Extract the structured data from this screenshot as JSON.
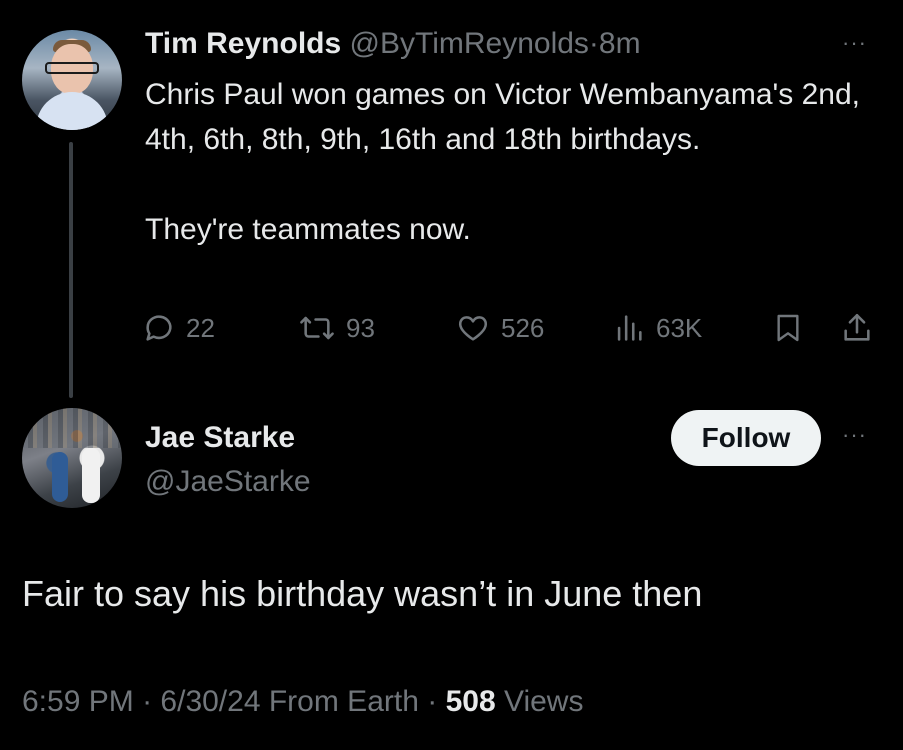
{
  "tweet1": {
    "author_name": "Tim Reynolds",
    "author_handle": "@ByTimReynolds",
    "separator": "·",
    "time_ago": "8m",
    "more": "···",
    "text_line1": "Chris Paul won games on Victor Wembanyama's 2nd, 4th, 6th, 8th, 9th, 16th and 18th birthdays.",
    "text_line2": "They're teammates now.",
    "replies": "22",
    "reposts": "93",
    "likes": "526",
    "views": "63K"
  },
  "tweet2": {
    "author_name": "Jae Starke",
    "author_handle": "@JaeStarke",
    "follow_label": "Follow",
    "more": "···",
    "text": "Fair to say his birthday wasn’t in June then",
    "time": "6:59 PM",
    "sep1": "·",
    "date": "6/30/24",
    "source": "From Earth",
    "sep2": "·",
    "views_count": "508",
    "views_label": "Views"
  },
  "colors": {
    "background": "#000000",
    "text_primary": "#e7e9ea",
    "text_secondary": "#71767b",
    "follow_bg": "#eff3f4"
  },
  "icons": [
    "reply-icon",
    "repost-icon",
    "like-icon",
    "views-icon",
    "bookmark-icon",
    "share-icon"
  ]
}
